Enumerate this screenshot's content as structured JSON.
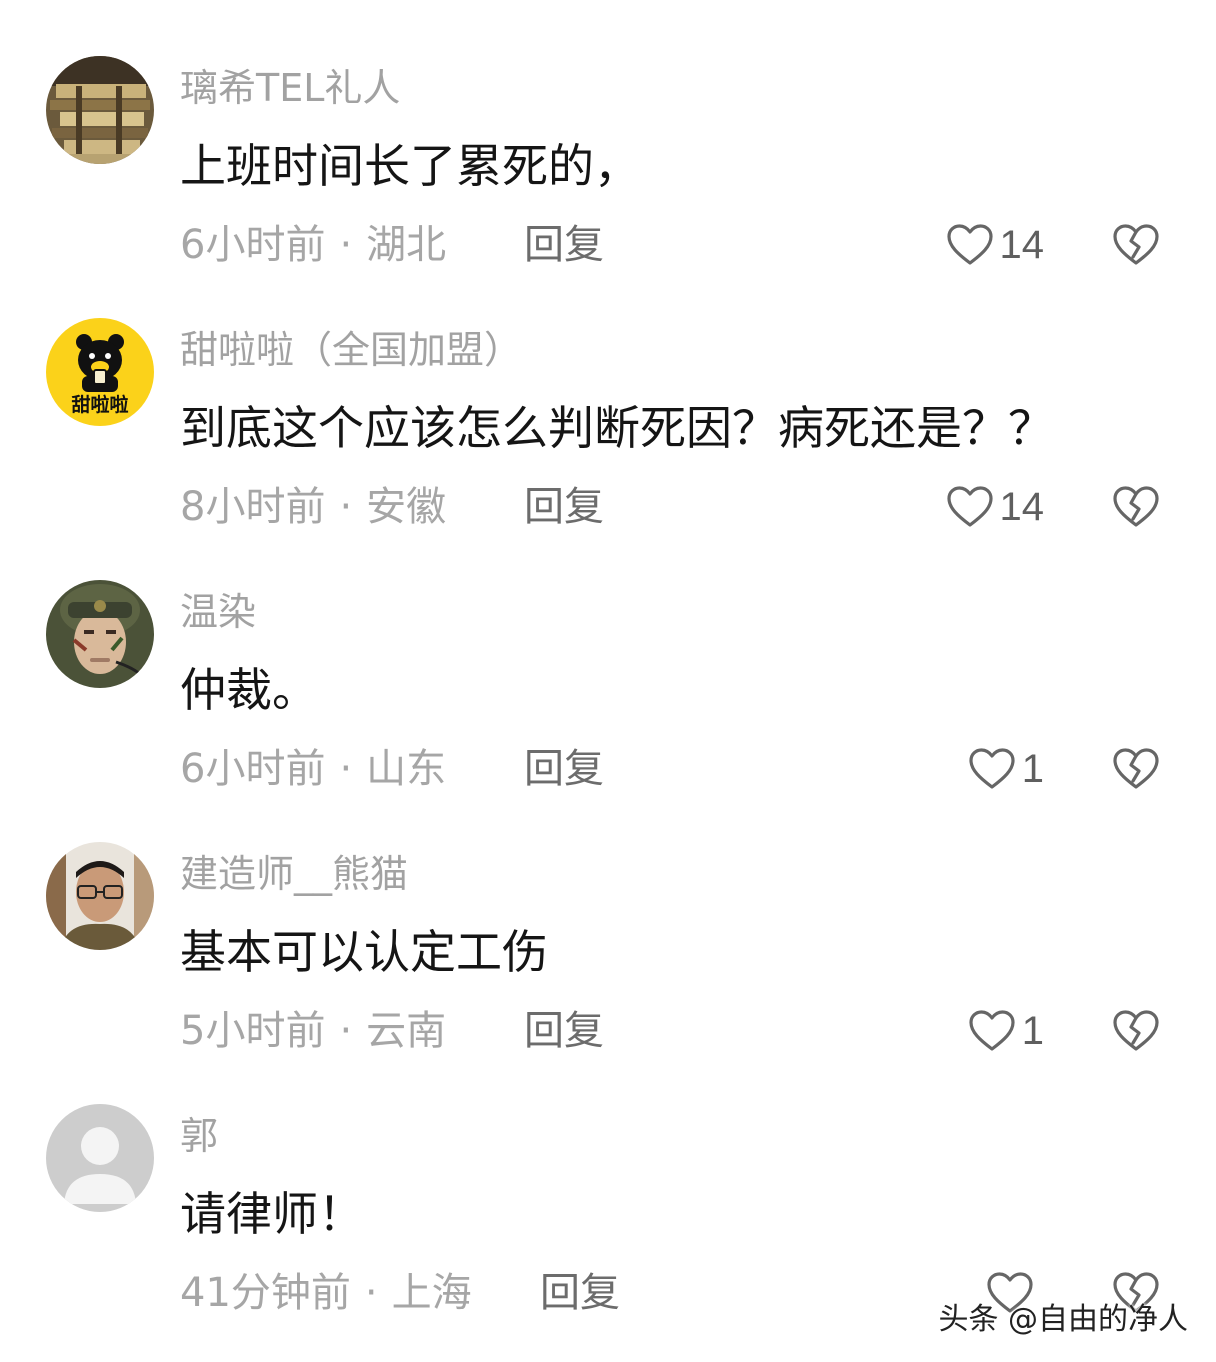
{
  "comments": [
    {
      "username": "璃希TEL礼人",
      "content": "上班时间长了累死的，",
      "time": "6小时前",
      "location": "湖北",
      "reply_label": "回复",
      "likes": "14",
      "avatar": "building-photo-avatar"
    },
    {
      "username": "甜啦啦（全国加盟）",
      "content": "到底这个应该怎么判断死因？病死还是？？",
      "time": "8小时前",
      "location": "安徽",
      "reply_label": "回复",
      "likes": "14",
      "avatar": "bear-logo-avatar",
      "avatar_text": "甜啦啦"
    },
    {
      "username": "温染",
      "content": "仲裁。",
      "time": "6小时前",
      "location": "山东",
      "reply_label": "回复",
      "likes": "1",
      "avatar": "soldier-photo-avatar"
    },
    {
      "username": "建造师__熊猫",
      "content": "基本可以认定工伤",
      "time": "5小时前",
      "location": "云南",
      "reply_label": "回复",
      "likes": "1",
      "avatar": "man-glasses-photo-avatar"
    },
    {
      "username": "郭",
      "content": "请律师！",
      "time": "41分钟前",
      "location": "上海",
      "reply_label": "回复",
      "likes": "",
      "avatar": "default-person-avatar"
    }
  ],
  "watermark": "头条 @自由的净人",
  "colors": {
    "username": "#a2a2a2",
    "content": "#151515",
    "meta": "#a6a6a6",
    "icon": "#666666",
    "brand_yellow": "#fbd21a"
  }
}
